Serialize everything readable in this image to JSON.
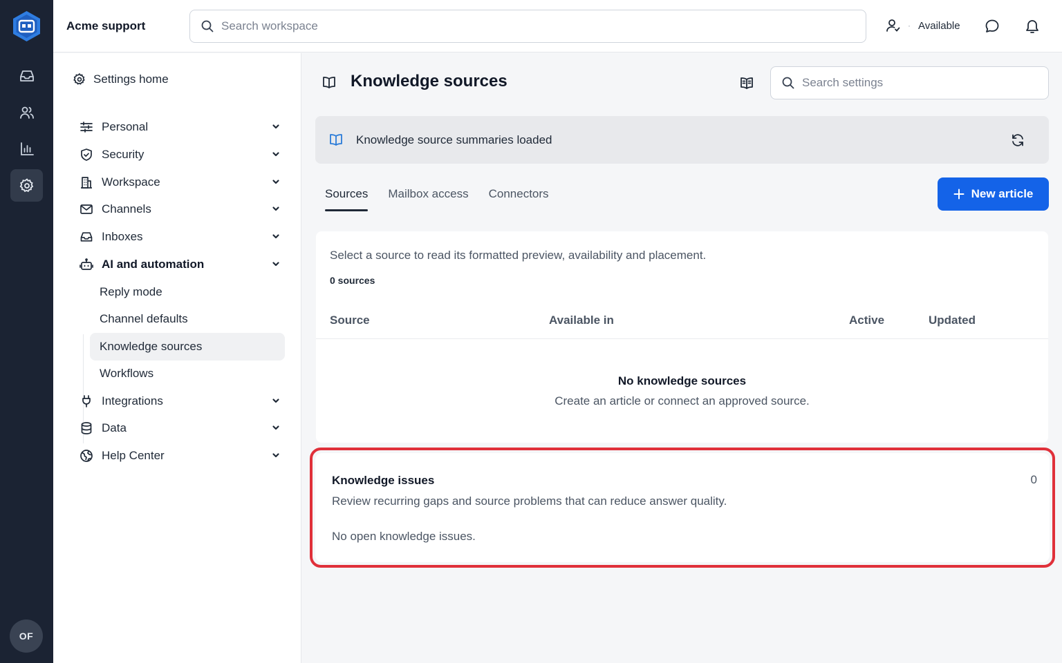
{
  "app": {
    "title": "Acme support"
  },
  "header": {
    "search_placeholder": "Search workspace",
    "status_label": "Available",
    "status_separator": "·"
  },
  "rail": {
    "items": [
      {
        "icon": "inbox-icon"
      },
      {
        "icon": "users-icon"
      },
      {
        "icon": "reports-icon"
      },
      {
        "icon": "settings-icon"
      }
    ],
    "avatar_initials": "OF"
  },
  "nav": {
    "home_label": "Settings home",
    "sections": [
      {
        "label": "Personal",
        "icon": "sliders-icon"
      },
      {
        "label": "Security",
        "icon": "shield-icon"
      },
      {
        "label": "Workspace",
        "icon": "building-icon"
      },
      {
        "label": "Channels",
        "icon": "mail-icon"
      },
      {
        "label": "Inboxes",
        "icon": "inbox-icon"
      },
      {
        "label": "AI and automation",
        "icon": "bot-icon",
        "expanded": true
      },
      {
        "label": "Integrations",
        "icon": "plug-icon"
      },
      {
        "label": "Data",
        "icon": "database-icon"
      },
      {
        "label": "Help Center",
        "icon": "globe-icon"
      }
    ],
    "sub_items": [
      {
        "label": "Reply mode"
      },
      {
        "label": "Channel defaults"
      },
      {
        "label": "Knowledge sources",
        "active": true
      },
      {
        "label": "Workflows"
      }
    ]
  },
  "page": {
    "title": "Knowledge sources",
    "settings_search_placeholder": "Search settings"
  },
  "banner": {
    "text": "Knowledge source summaries loaded"
  },
  "tabs": [
    {
      "label": "Sources",
      "active": true
    },
    {
      "label": "Mailbox access"
    },
    {
      "label": "Connectors"
    }
  ],
  "new_button": {
    "label": "New article",
    "color": "#1463e8"
  },
  "sources": {
    "description": "Select a source to read its formatted preview, availability and placement.",
    "count_label": "0 sources",
    "columns": [
      "Source",
      "Available in",
      "Active",
      "Updated"
    ],
    "empty_title": "No knowledge sources",
    "empty_subtitle": "Create an article or connect an approved source."
  },
  "issues": {
    "title": "Knowledge issues",
    "count": "0",
    "description": "Review recurring gaps and source problems that can reduce answer quality.",
    "empty_text": "No open knowledge issues.",
    "highlight_color": "#e0303a"
  }
}
